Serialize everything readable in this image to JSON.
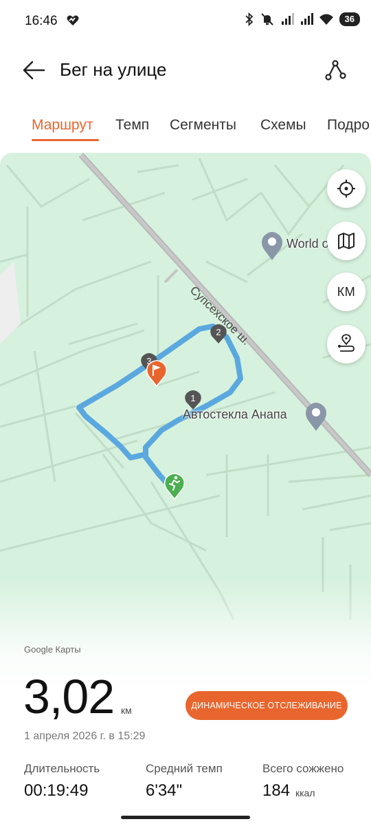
{
  "status": {
    "time": "16:46",
    "battery": "36"
  },
  "header": {
    "title": "Бег на улице",
    "back_icon": "arrow-left-icon",
    "route_icon": "route-share-icon"
  },
  "tabs": [
    {
      "label": "Маршрут",
      "active": true
    },
    {
      "label": "Темп",
      "active": false
    },
    {
      "label": "Сегменты",
      "active": false
    },
    {
      "label": "Схемы",
      "active": false
    },
    {
      "label": "Подро",
      "active": false
    }
  ],
  "map": {
    "pois": [
      "World of Ana",
      "Автостекла Анапа"
    ],
    "road": "Супсехское ш.",
    "markers": [
      "1",
      "2",
      "3"
    ],
    "attribution": "Google Карты",
    "buttons": {
      "locate_icon": "crosshair-icon",
      "layers_icon": "map-icon",
      "units_label": "КМ",
      "track_icon": "route-pin-icon"
    },
    "colors": {
      "route": "#5aa8df",
      "background": "#d6f1dd",
      "start": "#4caf50",
      "finish": "#e8662d"
    }
  },
  "stats": {
    "distance_value": "3,02",
    "distance_unit": "км",
    "live_tracking_label": "ДИНАМИЧЕСКОЕ ОТСЛЕЖИВАНИЕ",
    "date": "1 апреля 2026 г. в 15:29",
    "duration_label": "Длительность",
    "duration_value": "00:19:49",
    "pace_label": "Средний темп",
    "pace_value": "6'34\"",
    "calories_label": "Всего сожжено",
    "calories_value": "184",
    "calories_unit": "ккал"
  },
  "accent_color": "#e8662d"
}
